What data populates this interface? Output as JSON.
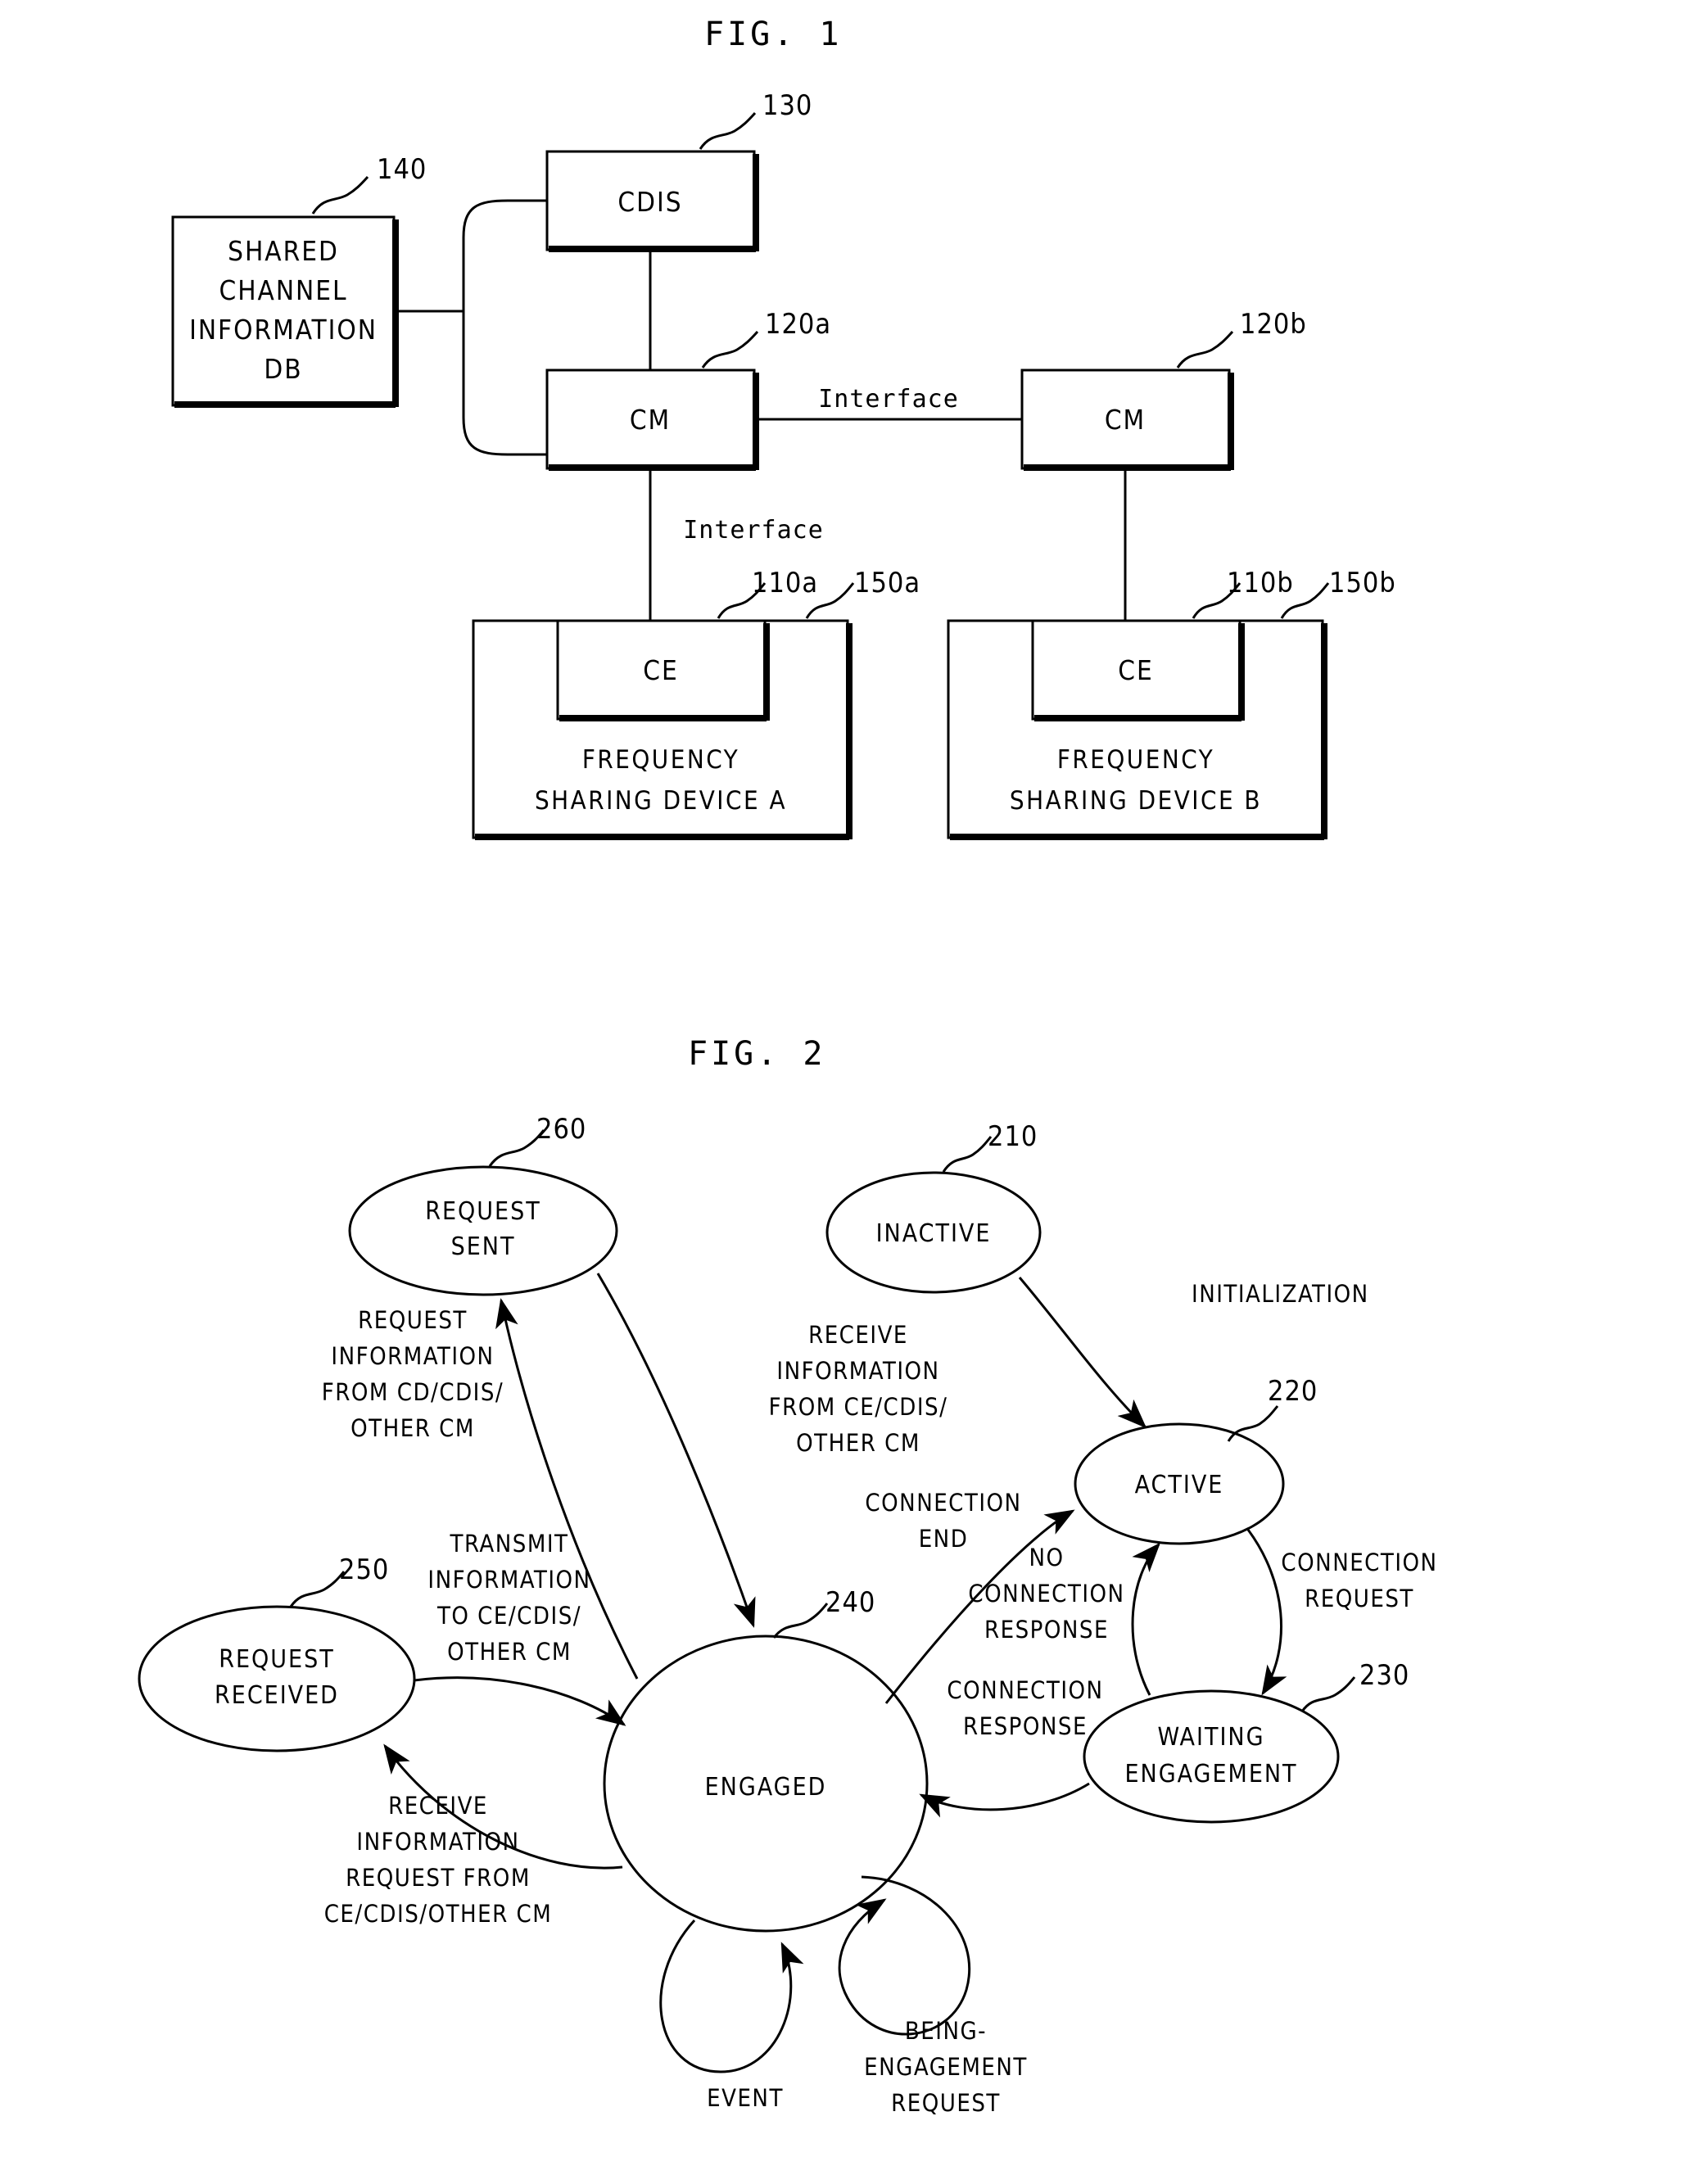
{
  "figures": [
    {
      "title": "FIG. 1",
      "type": "block-diagram",
      "blocks": [
        {
          "id": "140",
          "label_lines": [
            "SHARED",
            "CHANNEL",
            "INFORMATION",
            "DB"
          ],
          "ref": "140"
        },
        {
          "id": "130",
          "label_lines": [
            "CDIS"
          ],
          "ref": "130"
        },
        {
          "id": "120a",
          "label_lines": [
            "CM"
          ],
          "ref": "120a"
        },
        {
          "id": "120b",
          "label_lines": [
            "CM"
          ],
          "ref": "120b"
        },
        {
          "id": "110a",
          "label_lines": [
            "CE"
          ],
          "ref": "110a"
        },
        {
          "id": "110b",
          "label_lines": [
            "CE"
          ],
          "ref": "110b"
        },
        {
          "id": "150a",
          "label_lines": [
            "FREQUENCY",
            "SHARING DEVICE A"
          ],
          "ref": "150a"
        },
        {
          "id": "150b",
          "label_lines": [
            "FREQUENCY",
            "SHARING DEVICE B"
          ],
          "ref": "150b"
        }
      ],
      "connection_labels": [
        {
          "id": "if-cm-cm",
          "text": "Interface"
        },
        {
          "id": "if-cm-ce",
          "text": "Interface"
        }
      ]
    },
    {
      "title": "FIG. 2",
      "type": "state-diagram",
      "states": [
        {
          "id": "210",
          "label_lines": [
            "INACTIVE"
          ],
          "ref": "210"
        },
        {
          "id": "220",
          "label_lines": [
            "ACTIVE"
          ],
          "ref": "220"
        },
        {
          "id": "230",
          "label_lines": [
            "WAITING",
            "ENGAGEMENT"
          ],
          "ref": "230"
        },
        {
          "id": "240",
          "label_lines": [
            "ENGAGED"
          ],
          "ref": "240"
        },
        {
          "id": "250",
          "label_lines": [
            "REQUEST",
            "RECEIVED"
          ],
          "ref": "250"
        },
        {
          "id": "260",
          "label_lines": [
            "REQUEST",
            "SENT"
          ],
          "ref": "260"
        }
      ],
      "transitions": [
        {
          "id": "t-init",
          "from": "210",
          "to": "220",
          "label_lines": [
            "INITIALIZATION"
          ]
        },
        {
          "id": "t-conn-req",
          "from": "220",
          "to": "230",
          "label_lines": [
            "CONNECTION",
            "REQUEST"
          ]
        },
        {
          "id": "t-no-conn-resp",
          "from": "230",
          "to": "220",
          "label_lines": [
            "NO",
            "CONNECTION",
            "RESPONSE"
          ]
        },
        {
          "id": "t-conn-resp",
          "from": "230",
          "to": "240",
          "label_lines": [
            "CONNECTION",
            "RESPONSE"
          ]
        },
        {
          "id": "t-conn-end",
          "from": "240",
          "to": "220",
          "label_lines": [
            "CONNECTION",
            "END"
          ]
        },
        {
          "id": "t-req-info",
          "from": "240",
          "to": "260",
          "label_lines": [
            "REQUEST",
            "INFORMATION",
            "FROM CD/CDIS/",
            "OTHER CM"
          ]
        },
        {
          "id": "t-recv-info",
          "from": "260",
          "to": "240",
          "label_lines": [
            "RECEIVE",
            "INFORMATION",
            "FROM CE/CDIS/",
            "OTHER CM"
          ]
        },
        {
          "id": "t-recv-info-req",
          "from": "240",
          "to": "250",
          "label_lines": [
            "RECEIVE",
            "INFORMATION",
            "REQUEST FROM",
            "CE/CDIS/OTHER CM"
          ]
        },
        {
          "id": "t-transmit-info",
          "from": "250",
          "to": "240",
          "label_lines": [
            "TRANSMIT",
            "INFORMATION",
            "TO CE/CDIS/",
            "OTHER CM"
          ]
        },
        {
          "id": "t-event",
          "from": "240",
          "to": "240",
          "label_lines": [
            "EVENT"
          ]
        },
        {
          "id": "t-being-eng",
          "from": "240",
          "to": "240",
          "label_lines": [
            "BEING-",
            "ENGAGEMENT",
            "REQUEST"
          ]
        }
      ]
    }
  ],
  "colors": {
    "ink": "#000000",
    "paper": "#ffffff"
  }
}
